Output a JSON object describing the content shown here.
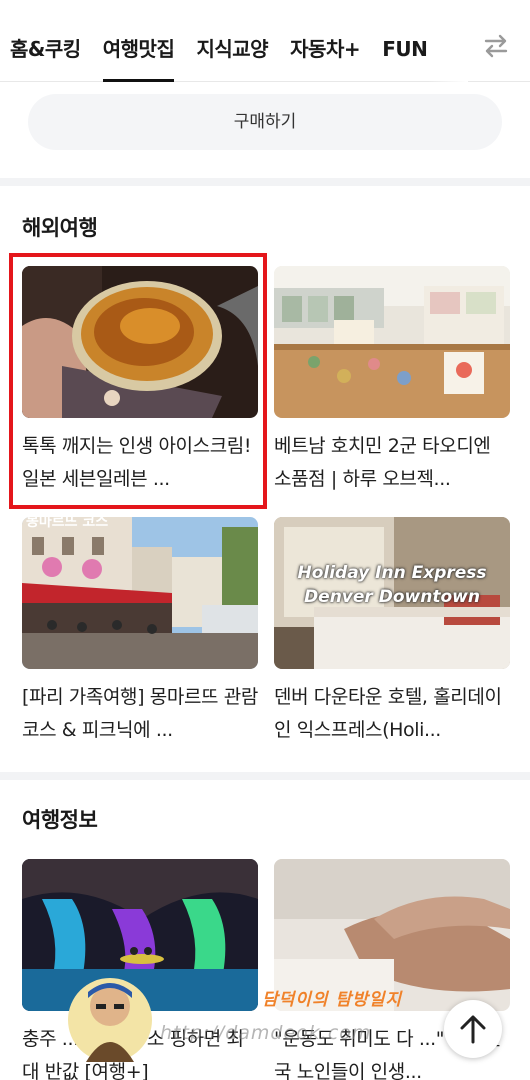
{
  "tabs": [
    {
      "label": "홈&쿠킹",
      "active": false
    },
    {
      "label": "여행맛집",
      "active": true
    },
    {
      "label": "지식교양",
      "active": false
    },
    {
      "label": "자동차+",
      "active": false
    },
    {
      "label": "FUN",
      "active": false
    }
  ],
  "buy_label": "구매하기",
  "sections": [
    {
      "title": "해외여행",
      "cards": [
        {
          "title": "톡톡 깨지는 인생 아이스크림! 일본 세븐일레븐 ...",
          "thumb_icon": "creme-brulee-photo",
          "highlighted": true
        },
        {
          "title": "베트남 호치민 2군 타오디엔 소품점 | 하루 오브젝...",
          "thumb_icon": "gift-shop-photo",
          "highlighted": false
        },
        {
          "title": "[파리 가족여행] 몽마르뜨 관람 코스 & 피크닉에 ...",
          "thumb_icon": "paris-street-photo",
          "thumb_caption": "몽마르뜨 코스",
          "highlighted": false
        },
        {
          "title": "덴버 다운타운 호텔, 홀리데이인 익스프레스(Holi...",
          "thumb_icon": "hotel-room-photo",
          "thumb_caption": "Holiday Inn Express Denver Downtown",
          "highlighted": false
        }
      ]
    },
    {
      "title": "여행정보",
      "cards": [
        {
          "title": "충주 ... 서 숙박·소 핑하면 최대 반값 [여행+]",
          "thumb_icon": "cave-lights-photo",
          "highlighted": false
        },
        {
          "title": "\"운동도 취미도 다 ...\" 대한민국 노인들이 인생...",
          "thumb_icon": "elderly-hands-photo",
          "highlighted": false
        }
      ]
    }
  ],
  "watermark": {
    "name": "담덕이의 탐방일지",
    "url": "http://damdeok.com"
  },
  "icons": {
    "swap": "swap-arrows-icon",
    "scroll_top": "arrow-up-icon"
  },
  "colors": {
    "highlight": "#e4161b",
    "watermark_name": "#f0822a"
  }
}
